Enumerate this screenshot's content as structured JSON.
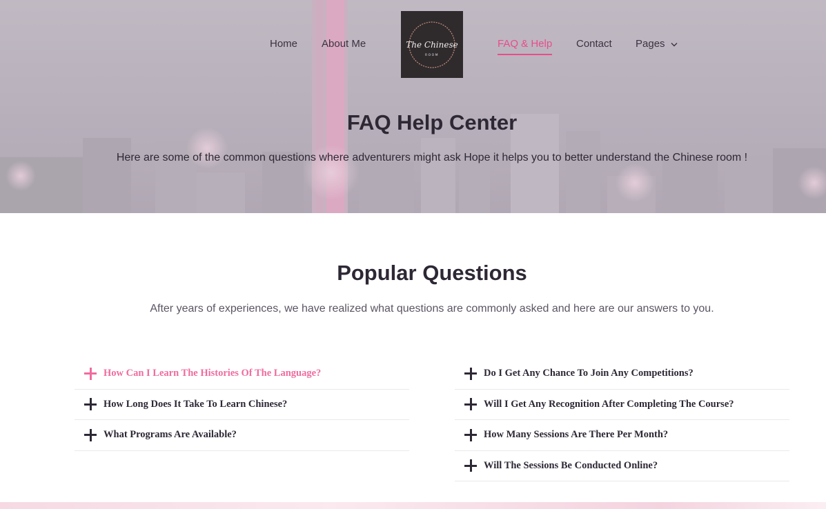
{
  "nav": {
    "items": [
      {
        "label": "Home"
      },
      {
        "label": "About Me"
      },
      {
        "label": "FAQ & Help"
      },
      {
        "label": "Contact"
      },
      {
        "label": "Pages"
      }
    ],
    "active_label": "FAQ & Help",
    "logo_text": {
      "line1": "The Chinese",
      "line2": "ROOM"
    }
  },
  "hero": {
    "title": "FAQ Help Center",
    "subtitle": "Here are some of the common questions where adventurers might ask Hope it helps you to better understand the Chinese room !"
  },
  "popular": {
    "title": "Popular Questions",
    "subtitle": "After years of experiences, we have realized what questions are commonly asked and here are our answers to you.",
    "left": [
      {
        "question": "How Can I Learn The Histories Of The Language?",
        "active": true
      },
      {
        "question": "How Long Does It Take To Learn Chinese?",
        "active": false
      },
      {
        "question": "What Programs Are Available?",
        "active": false
      }
    ],
    "right": [
      {
        "question": "Do I Get Any Chance To Join Any Competitions?",
        "active": false
      },
      {
        "question": "Will I Get Any Recognition After Completing The Course?",
        "active": false
      },
      {
        "question": "How Many Sessions Are There Per Month?",
        "active": false
      },
      {
        "question": "Will The Sessions Be Conducted Online?",
        "active": false
      }
    ]
  },
  "colors": {
    "accent": "#e84c8b",
    "active_question": "#f06b9e",
    "text_dark": "#2e2835",
    "logo_bg": "#2f2b2d"
  },
  "icons": {
    "toggle": "plus-icon",
    "dropdown": "chevron-down-icon"
  }
}
